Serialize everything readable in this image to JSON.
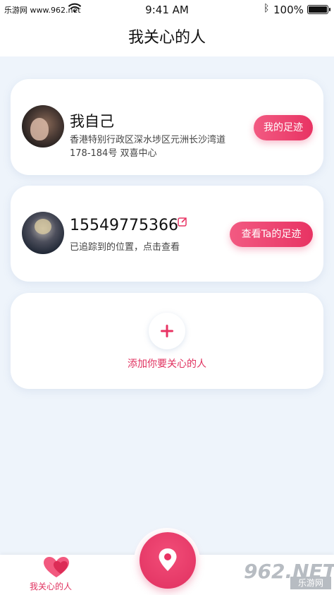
{
  "status": {
    "source": "乐游网 www.962.net",
    "time": "9:41 AM",
    "battery": "100%"
  },
  "nav": {
    "title": "我关心的人"
  },
  "cards": [
    {
      "name": "我自己",
      "address": "香港特别行政区深水埗区元洲长沙湾道178-184号 双喜中心",
      "button": "我的足迹"
    },
    {
      "name": "15549775366",
      "description": "已追踪到的位置，点击查看",
      "button": "查看Ta的足迹"
    }
  ],
  "add": {
    "label": "添加你要关心的人"
  },
  "tabbar": {
    "tab_label": "我关心的人"
  },
  "watermark": {
    "main": "962.NET",
    "sub": "乐游网"
  },
  "colors": {
    "accent": "#e83363",
    "background": "#eef4fb"
  },
  "icons": {
    "wifi": "wifi-icon",
    "bluetooth": "bluetooth-icon",
    "battery": "battery-icon",
    "edit": "edit-icon",
    "add": "plus-icon",
    "heart": "heart-icon",
    "location": "location-pin-icon"
  }
}
